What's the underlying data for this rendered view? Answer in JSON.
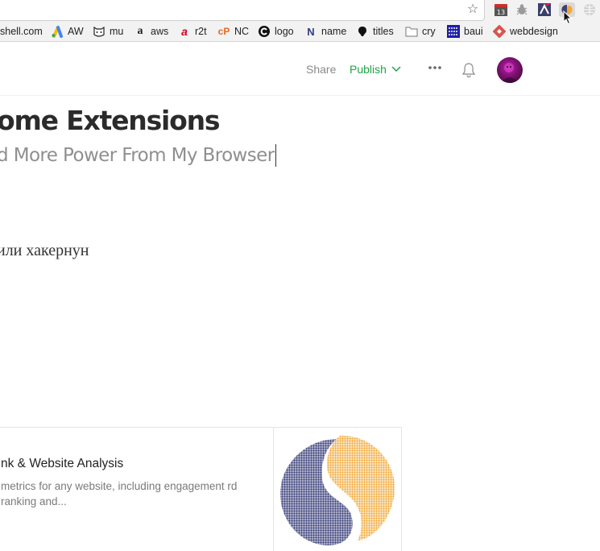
{
  "browser": {
    "bookmarks": [
      {
        "label": "shell.com",
        "icon": "page-icon"
      },
      {
        "label": "AW",
        "icon": "adwords-icon"
      },
      {
        "label": "mu",
        "icon": "cat-face-icon"
      },
      {
        "label": "aws",
        "icon": "amazon-icon"
      },
      {
        "label": "r2t",
        "icon": "r2t-icon"
      },
      {
        "label": "NC",
        "icon": "namecheap-icon"
      },
      {
        "label": "logo",
        "icon": "logo-site-icon"
      },
      {
        "label": "name",
        "icon": "name-site-icon"
      },
      {
        "label": "titles",
        "icon": "bullet-icon"
      },
      {
        "label": "cry",
        "icon": "folder-icon"
      },
      {
        "label": "baui",
        "icon": "baui-icon"
      },
      {
        "label": "webdesign",
        "icon": "webdesign-icon"
      }
    ],
    "calendar_day": "13",
    "extensions": [
      "calendar-icon",
      "bug-icon",
      "extension-a-icon",
      "similarweb-extension-icon",
      "globe-icon"
    ]
  },
  "toolbar": {
    "share_label": "Share",
    "publish_label": "Publish"
  },
  "article": {
    "title": "ome Extensions",
    "subtitle": "d More Power From My Browser",
    "body": "или хакернун"
  },
  "embed": {
    "title": "nk & Website Analysis",
    "description": "metrics for any website, including engagement rd ranking and..."
  },
  "colors": {
    "accent_green": "#1fa34a",
    "logo_navy": "#3d4176",
    "logo_orange": "#f2a93b"
  }
}
